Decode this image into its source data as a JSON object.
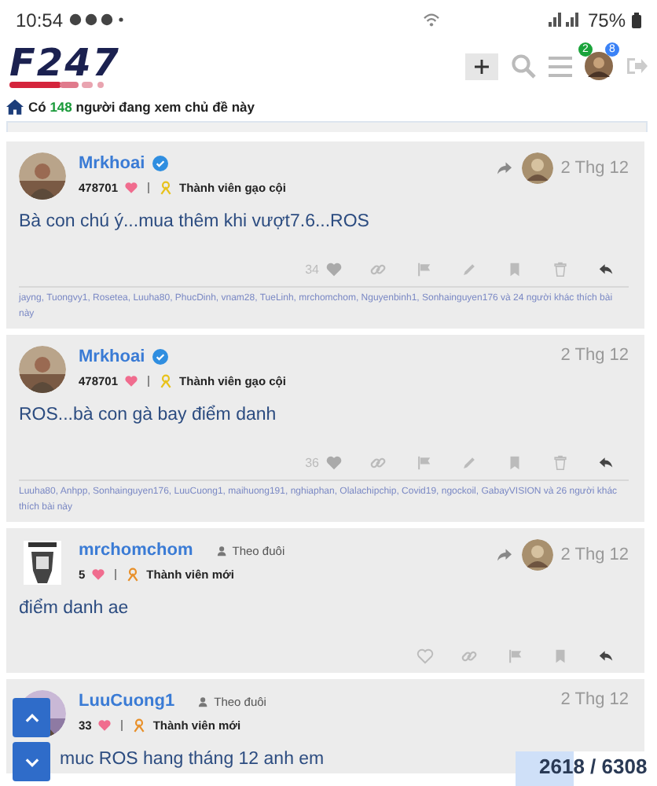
{
  "status_bar": {
    "time": "10:54",
    "battery": "75%"
  },
  "header": {
    "logo": "F247",
    "badges": [
      {
        "count": "2",
        "color": "#1aa33a"
      },
      {
        "count": "8",
        "color": "#3b82f6"
      }
    ]
  },
  "viewers": {
    "prefix": "Có",
    "count": "148",
    "suffix": "người đang xem chủ đề này"
  },
  "posts": [
    {
      "author": "Mrkhoai",
      "verified": true,
      "points": "478701",
      "rank": {
        "label": "Thành viên gạo cội",
        "color": "#e8c21a"
      },
      "date": "2 Thg 12",
      "reply_to": true,
      "text": "Bà con chú ý...mua thêm khi vượt7.6...ROS",
      "like_count": "34",
      "actions": [
        {
          "kind": "like"
        },
        {
          "kind": "link"
        },
        {
          "kind": "flag"
        },
        {
          "kind": "edit"
        },
        {
          "kind": "bookmark"
        },
        {
          "kind": "delete"
        },
        {
          "kind": "reply"
        }
      ],
      "likers": "jayng, Tuongvy1, Rosetea, Luuha80, PhucDinh, vnam28, TueLinh, mrchomchom, Nguyenbinh1, Sonhainguyen176 và 24 người khác thích bài này"
    },
    {
      "author": "Mrkhoai",
      "verified": true,
      "points": "478701",
      "rank": {
        "label": "Thành viên gạo cội",
        "color": "#e8c21a"
      },
      "date": "2 Thg 12",
      "reply_to": false,
      "text": "ROS...bà con gà bay điểm danh",
      "like_count": "36",
      "actions": [
        {
          "kind": "like"
        },
        {
          "kind": "link"
        },
        {
          "kind": "flag"
        },
        {
          "kind": "edit"
        },
        {
          "kind": "bookmark"
        },
        {
          "kind": "delete"
        },
        {
          "kind": "reply"
        }
      ],
      "likers": "Luuha80, Anhpp, Sonhainguyen176, LuuCuong1, maihuong191, nghiaphan, Olalachipchip, Covid19, ngockoil, GabayVISION và 26 người khác thích bài này"
    },
    {
      "author": "mrchomchom",
      "verified": false,
      "follow": "Theo đuôi",
      "points": "5",
      "rank": {
        "label": "Thành viên mới",
        "color": "#e8902a"
      },
      "date": "2 Thg 12",
      "reply_to": true,
      "text": "điểm danh ae",
      "actions": [
        {
          "kind": "like"
        },
        {
          "kind": "link"
        },
        {
          "kind": "flag"
        },
        {
          "kind": "bookmark"
        },
        {
          "kind": "reply"
        }
      ]
    },
    {
      "author": "LuuCuong1",
      "verified": false,
      "follow": "Theo đuôi",
      "points": "33",
      "rank": {
        "label": "Thành viên mới",
        "color": "#e8902a"
      },
      "date": "2 Thg 12",
      "reply_to": false,
      "text": "muc ROS hang tháng 12 anh em"
    }
  ],
  "progress": {
    "reading": "2618 / 6308",
    "level": 0.41
  }
}
